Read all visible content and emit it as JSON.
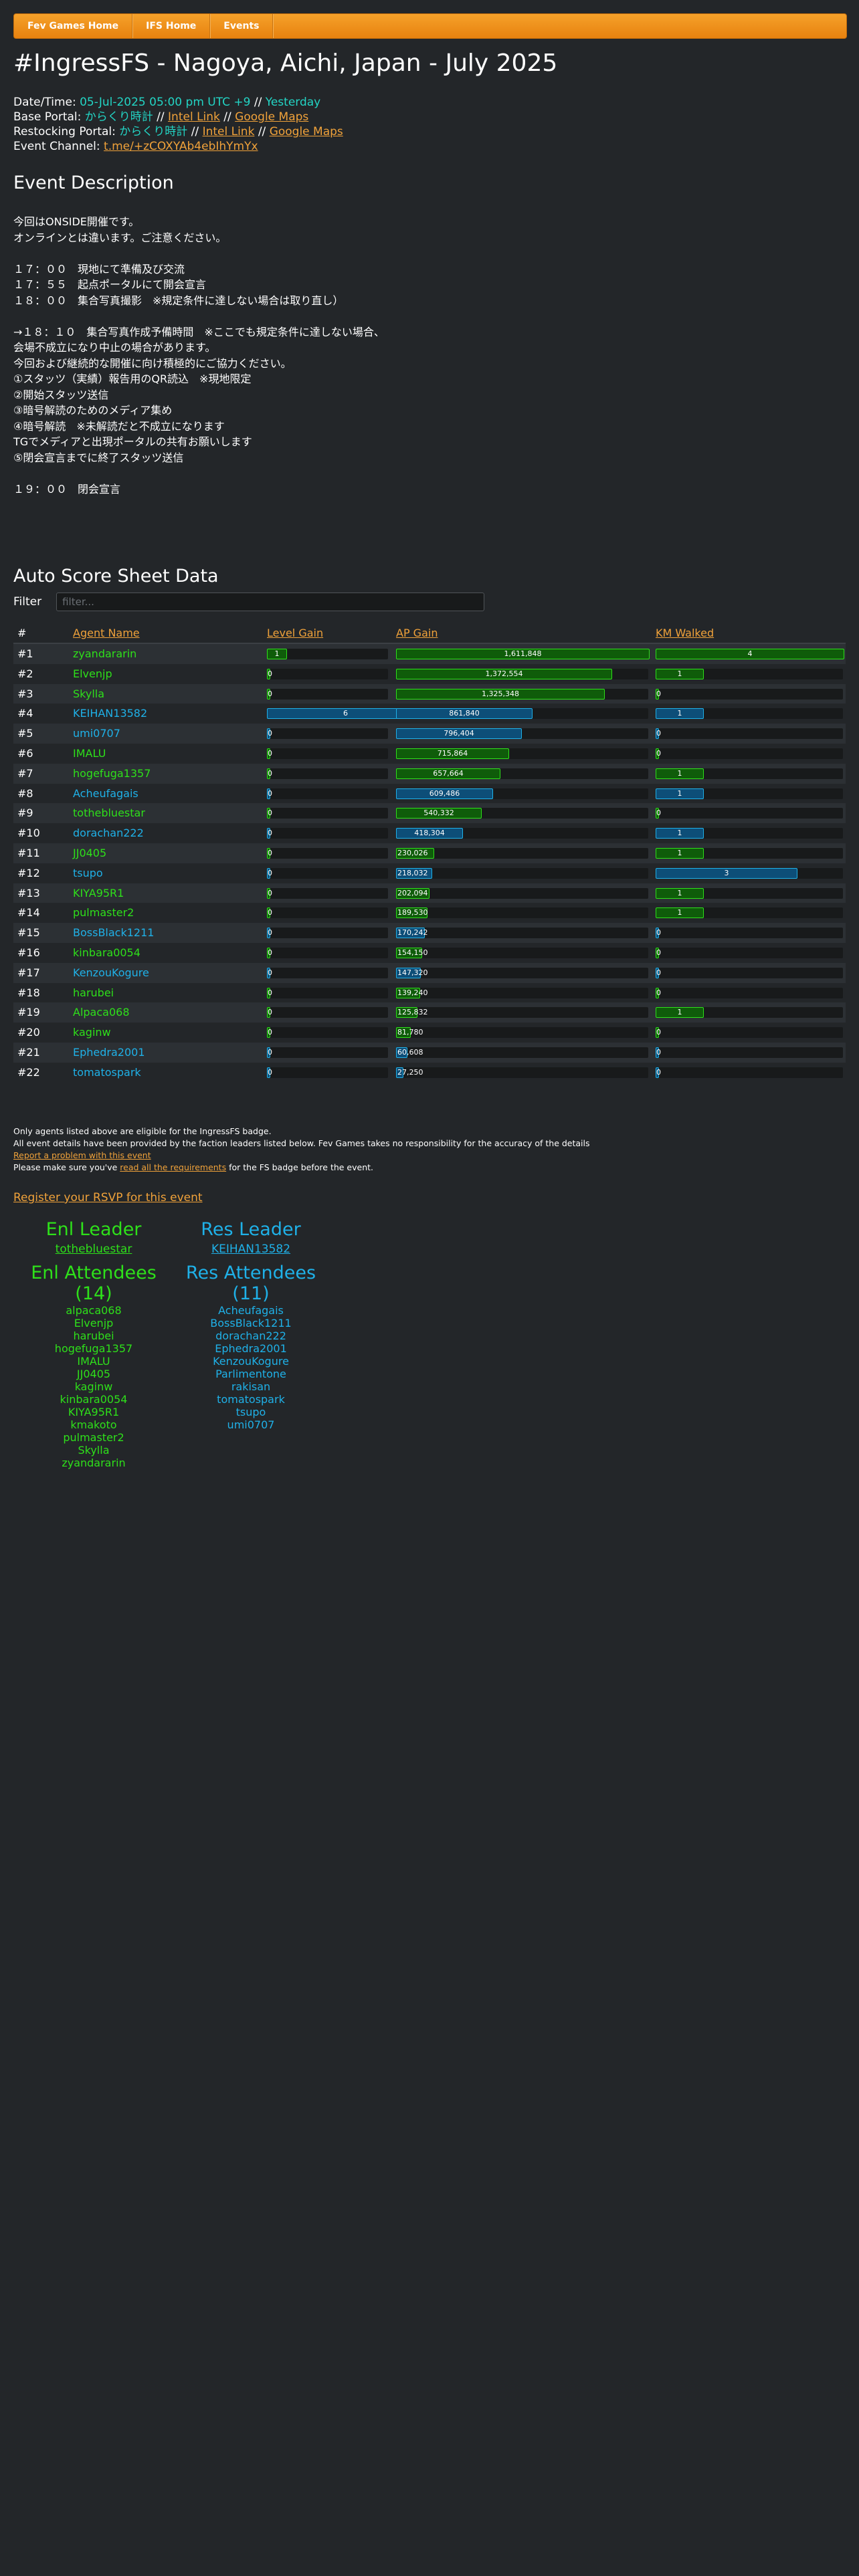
{
  "nav": [
    "Fev Games Home",
    "IFS Home",
    "Events"
  ],
  "title": "#IngressFS - Nagoya, Aichi, Japan - July 2025",
  "meta": {
    "datetime_label": "Date/Time: ",
    "datetime": "05-Jul-2025 05:00 pm UTC +9",
    "sep": " // ",
    "yesterday": "Yesterday",
    "base_label": "Base Portal: ",
    "base_name": "からくり時計",
    "restock_label": "Restocking Portal: ",
    "restock_name": "からくり時計",
    "intel_link": "Intel Link",
    "google_maps": "Google Maps",
    "channel_label": "Event Channel: ",
    "channel": "t.me/+zCOXYAb4ebIhYmYx"
  },
  "description_heading": "Event Description",
  "description": "今回はONSIDE開催です。\nオンラインとは違います。ご注意ください。\n\n１７：００　現地にて準備及び交流\n１７：５５　起点ポータルにて開会宣言\n１８：００　集合写真撮影　※規定条件に達しない場合は取り直し）\n\n→１８：１０　集合写真作成予備時間　※ここでも規定条件に達しない場合、\n会場不成立になり中止の場合があります。\n今回および継続的な開催に向け積極的にご協力ください。\n①スタッツ（実績）報告用のQR読込　※現地限定\n②開始スタッツ送信\n③暗号解読のためのメディア集め\n④暗号解読　※未解読だと不成立になります\nTGでメディアと出現ポータルの共有お願いします\n⑤閉会宣言までに終了スタッツ送信\n\n１９：００　閉会宣言",
  "scoresheet_heading": "Auto Score Sheet Data",
  "filter_label": "Filter",
  "filter_placeholder": "filter...",
  "table_headers": [
    "#",
    "Agent Name",
    "Level Gain",
    "AP Gain",
    "KM Walked"
  ],
  "rows": [
    {
      "rank": "#1",
      "name": "zyandararin",
      "faction": "enl",
      "level": 1,
      "ap": 1611848,
      "ap_text": "1,611,848",
      "km": 4
    },
    {
      "rank": "#2",
      "name": "Elvenjp",
      "faction": "enl",
      "level": 0,
      "ap": 1372554,
      "ap_text": "1,372,554",
      "km": 1
    },
    {
      "rank": "#3",
      "name": "Skylla",
      "faction": "enl",
      "level": 0,
      "ap": 1325348,
      "ap_text": "1,325,348",
      "km": 0
    },
    {
      "rank": "#4",
      "name": "KEIHAN13582",
      "faction": "res",
      "level": 6,
      "ap": 861840,
      "ap_text": "861,840",
      "km": 1
    },
    {
      "rank": "#5",
      "name": "umi0707",
      "faction": "res",
      "level": 0,
      "ap": 796404,
      "ap_text": "796,404",
      "km": 0
    },
    {
      "rank": "#6",
      "name": "IMALU",
      "faction": "enl",
      "level": 0,
      "ap": 715864,
      "ap_text": "715,864",
      "km": 0
    },
    {
      "rank": "#7",
      "name": "hogefuga1357",
      "faction": "enl",
      "level": 0,
      "ap": 657664,
      "ap_text": "657,664",
      "km": 1
    },
    {
      "rank": "#8",
      "name": "Acheufagais",
      "faction": "res",
      "level": 0,
      "ap": 609486,
      "ap_text": "609,486",
      "km": 1
    },
    {
      "rank": "#9",
      "name": "tothebluestar",
      "faction": "enl",
      "level": 0,
      "ap": 540332,
      "ap_text": "540,332",
      "km": 0
    },
    {
      "rank": "#10",
      "name": "dorachan222",
      "faction": "res",
      "level": 0,
      "ap": 418304,
      "ap_text": "418,304",
      "km": 1
    },
    {
      "rank": "#11",
      "name": "JJ0405",
      "faction": "enl",
      "level": 0,
      "ap": 230026,
      "ap_text": "230,026",
      "km": 1
    },
    {
      "rank": "#12",
      "name": "tsupo",
      "faction": "res",
      "level": 0,
      "ap": 218032,
      "ap_text": "218,032",
      "km": 3
    },
    {
      "rank": "#13",
      "name": "KIYA95R1",
      "faction": "enl",
      "level": 0,
      "ap": 202094,
      "ap_text": "202,094",
      "km": 1
    },
    {
      "rank": "#14",
      "name": "pulmaster2",
      "faction": "enl",
      "level": 0,
      "ap": 189530,
      "ap_text": "189,530",
      "km": 1
    },
    {
      "rank": "#15",
      "name": "BossBlack1211",
      "faction": "res",
      "level": 0,
      "ap": 170242,
      "ap_text": "170,242",
      "km": 0
    },
    {
      "rank": "#16",
      "name": "kinbara0054",
      "faction": "enl",
      "level": 0,
      "ap": 154150,
      "ap_text": "154,150",
      "km": 0
    },
    {
      "rank": "#17",
      "name": "KenzouKogure",
      "faction": "res",
      "level": 0,
      "ap": 147320,
      "ap_text": "147,320",
      "km": 0
    },
    {
      "rank": "#18",
      "name": "harubei",
      "faction": "enl",
      "level": 0,
      "ap": 139240,
      "ap_text": "139,240",
      "km": 0
    },
    {
      "rank": "#19",
      "name": "Alpaca068",
      "faction": "enl",
      "level": 0,
      "ap": 125832,
      "ap_text": "125,832",
      "km": 1
    },
    {
      "rank": "#20",
      "name": "kaginw",
      "faction": "enl",
      "level": 0,
      "ap": 81780,
      "ap_text": "81,780",
      "km": 0
    },
    {
      "rank": "#21",
      "name": "Ephedra2001",
      "faction": "res",
      "level": 0,
      "ap": 60608,
      "ap_text": "60,608",
      "km": 0
    },
    {
      "rank": "#22",
      "name": "tomatospark",
      "faction": "res",
      "level": 0,
      "ap": 27250,
      "ap_text": "27,250",
      "km": 0
    }
  ],
  "scale": {
    "level_max": 6,
    "ap_max": 1611848,
    "km_max": 4
  },
  "footer": {
    "line1": "Only agents listed above are eligible for the IngressFS badge.",
    "line2": "All event details have been provided by the faction leaders listed below. Fev Games takes no responsibility for the accuracy of the details",
    "report": "Report a problem with this event",
    "line4_pre": "Please make sure you've ",
    "line4_link": "read all the requirements",
    "line4_post": " for the FS badge before the event."
  },
  "rsvp": "Register your RSVP for this event",
  "enl": {
    "leader_heading": "Enl Leader",
    "leader": "tothebluestar",
    "attendees_heading": "Enl Attendees (14)",
    "attendees": [
      "alpaca068",
      "Elvenjp",
      "harubei",
      "hogefuga1357",
      "IMALU",
      "JJ0405",
      "kaginw",
      "kinbara0054",
      "KIYA95R1",
      "kmakoto",
      "pulmaster2",
      "Skylla",
      "zyandararin"
    ]
  },
  "res": {
    "leader_heading": "Res Leader",
    "leader": "KEIHAN13582",
    "attendees_heading": "Res Attendees (11)",
    "attendees": [
      "Acheufagais",
      "BossBlack1211",
      "dorachan222",
      "Ephedra2001",
      "KenzouKogure",
      "Parlimentone",
      "rakisan",
      "tomatospark",
      "tsupo",
      "umi0707"
    ]
  },
  "colors": {
    "enl": "#2ee01a",
    "res": "#1fb1e8",
    "accent": "#f0a23a",
    "nav": "#e8820f",
    "bg": "#232629"
  }
}
